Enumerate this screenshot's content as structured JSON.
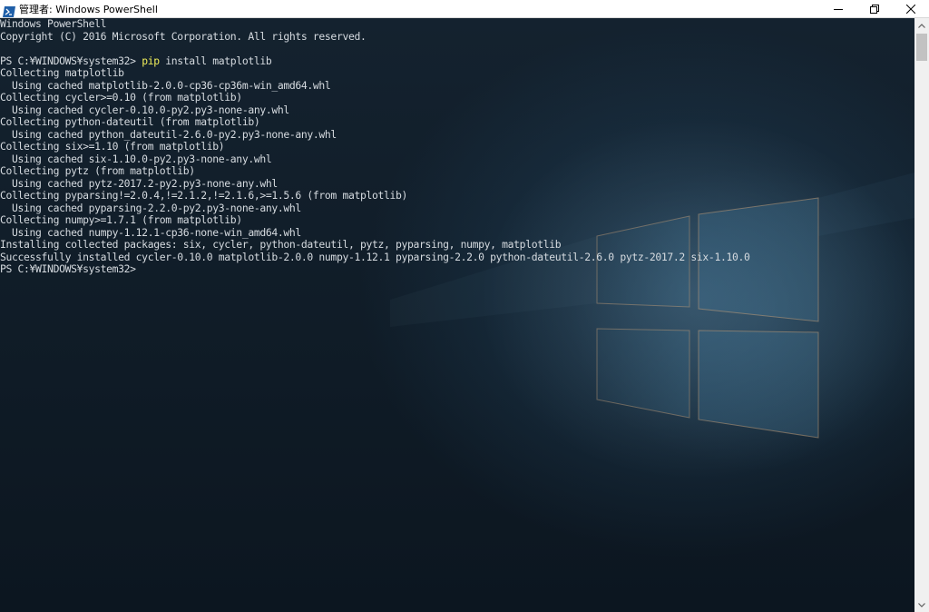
{
  "window": {
    "title": "管理者: Windows PowerShell",
    "controls": {
      "minimize": "minimize-icon",
      "maximize": "restore-icon",
      "close": "close-icon"
    }
  },
  "console": {
    "lines": [
      {
        "text": "Windows PowerShell"
      },
      {
        "text": "Copyright (C) 2016 Microsoft Corporation. All rights reserved."
      },
      {
        "text": ""
      },
      {
        "prompt": "PS C:¥WINDOWS¥system32> ",
        "verb": "pip",
        "args": " install matplotlib"
      },
      {
        "text": "Collecting matplotlib"
      },
      {
        "text": "  Using cached matplotlib-2.0.0-cp36-cp36m-win_amd64.whl"
      },
      {
        "text": "Collecting cycler>=0.10 (from matplotlib)"
      },
      {
        "text": "  Using cached cycler-0.10.0-py2.py3-none-any.whl"
      },
      {
        "text": "Collecting python-dateutil (from matplotlib)"
      },
      {
        "text": "  Using cached python_dateutil-2.6.0-py2.py3-none-any.whl"
      },
      {
        "text": "Collecting six>=1.10 (from matplotlib)"
      },
      {
        "text": "  Using cached six-1.10.0-py2.py3-none-any.whl"
      },
      {
        "text": "Collecting pytz (from matplotlib)"
      },
      {
        "text": "  Using cached pytz-2017.2-py2.py3-none-any.whl"
      },
      {
        "text": "Collecting pyparsing!=2.0.4,!=2.1.2,!=2.1.6,>=1.5.6 (from matplotlib)"
      },
      {
        "text": "  Using cached pyparsing-2.2.0-py2.py3-none-any.whl"
      },
      {
        "text": "Collecting numpy>=1.7.1 (from matplotlib)"
      },
      {
        "text": "  Using cached numpy-1.12.1-cp36-none-win_amd64.whl"
      },
      {
        "text": "Installing collected packages: six, cycler, python-dateutil, pytz, pyparsing, numpy, matplotlib"
      },
      {
        "text": "Successfully installed cycler-0.10.0 matplotlib-2.0.0 numpy-1.12.1 pyparsing-2.2.0 python-dateutil-2.6.0 pytz-2017.2 six-1.10.0"
      },
      {
        "text": "PS C:¥WINDOWS¥system32>"
      }
    ]
  },
  "colors": {
    "console_text": "#d6dbe0",
    "command_verb": "#f2ef5a",
    "background": "#0f1b26"
  },
  "icons": {
    "app": "powershell-icon"
  }
}
